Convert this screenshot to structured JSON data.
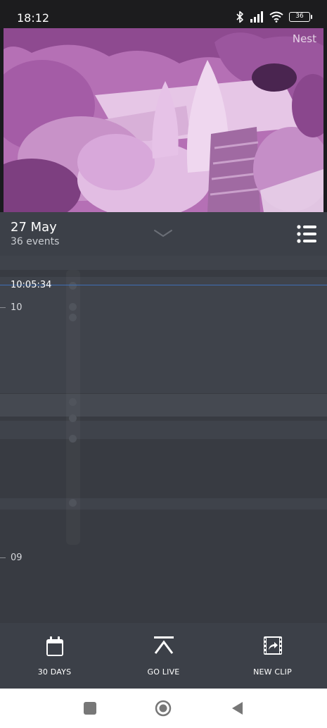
{
  "status_bar": {
    "time": "18:12",
    "battery": "36",
    "icons": [
      "bluetooth-icon",
      "signal-icon",
      "wifi-icon",
      "battery-icon"
    ]
  },
  "camera": {
    "brand": "Nest"
  },
  "panel": {
    "date": "27 May",
    "events": "36 events"
  },
  "timeline": {
    "current_time": "10:05:34",
    "hours": [
      "10",
      "09"
    ]
  },
  "toolbar": {
    "days_label": "30 DAYS",
    "live_label": "GO LIVE",
    "clip_label": "NEW CLIP"
  },
  "navigation": {
    "icons": [
      "recents-square-icon",
      "home-circle-icon",
      "back-triangle-icon"
    ]
  },
  "colors": {
    "panel_bg": "#3c4048",
    "timeline_bg": "#383b42",
    "now_line": "#3f6fb5",
    "camera_tint": "#b86fb8"
  }
}
